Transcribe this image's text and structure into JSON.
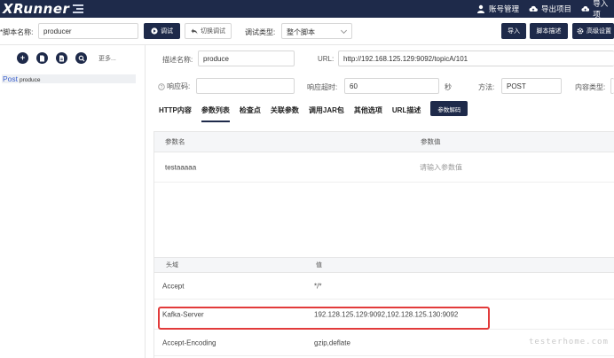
{
  "app": {
    "logo": "XRunner"
  },
  "nav": {
    "account": "账号管理",
    "export_project": "导出项目",
    "import_project": "导入项"
  },
  "toolbar": {
    "script_name_label": "*脚本名称:",
    "script_name_value": "producer",
    "debug_button": "调试",
    "switch_debug_button": "切换调试",
    "debug_type_label": "调试类型:",
    "debug_type_value": "整个脚本",
    "import_button": "导入",
    "script_desc_button": "脚本描述",
    "advanced_button": "高级设置"
  },
  "sidebar": {
    "more": "更多...",
    "tree": [
      {
        "method": "Post",
        "name": "produce"
      }
    ]
  },
  "form": {
    "desc_label": "描述名称:",
    "desc_value": "produce",
    "url_label": "URL:",
    "url_value": "http://192.168.125.129:9092/topicA/101",
    "resp_code_label": "响应码:",
    "resp_code_value": "",
    "timeout_label": "响应超时:",
    "timeout_value": "60",
    "timeout_unit": "秒",
    "method_label": "方法:",
    "method_value": "POST",
    "content_type_label": "内容类型:"
  },
  "tabs": [
    {
      "label": "HTTP内容"
    },
    {
      "label": "参数列表"
    },
    {
      "label": "检查点"
    },
    {
      "label": "关联参数"
    },
    {
      "label": "调用JAR包"
    },
    {
      "label": "其他选项"
    },
    {
      "label": "URL描述"
    }
  ],
  "tab_button": "参数解码",
  "params_table": {
    "headers": [
      "参数名",
      "参数值"
    ],
    "rows": [
      {
        "name": "testaaaaa",
        "value": "请输入参数值"
      }
    ]
  },
  "headers_table": {
    "headers": [
      "头域",
      "值"
    ],
    "rows": [
      {
        "name": "Accept",
        "value": "*/*"
      },
      {
        "name": "Kafka-Server",
        "value": "192.128.125.129:9092,192.128.125.130:9092"
      },
      {
        "name": "Accept-Encoding",
        "value": "gzip,deflate"
      }
    ]
  },
  "watermark": "testerhome.com",
  "colors": {
    "primary": "#1e2a4a",
    "highlight": "#e23b3b",
    "method": "#3a5fcd"
  }
}
